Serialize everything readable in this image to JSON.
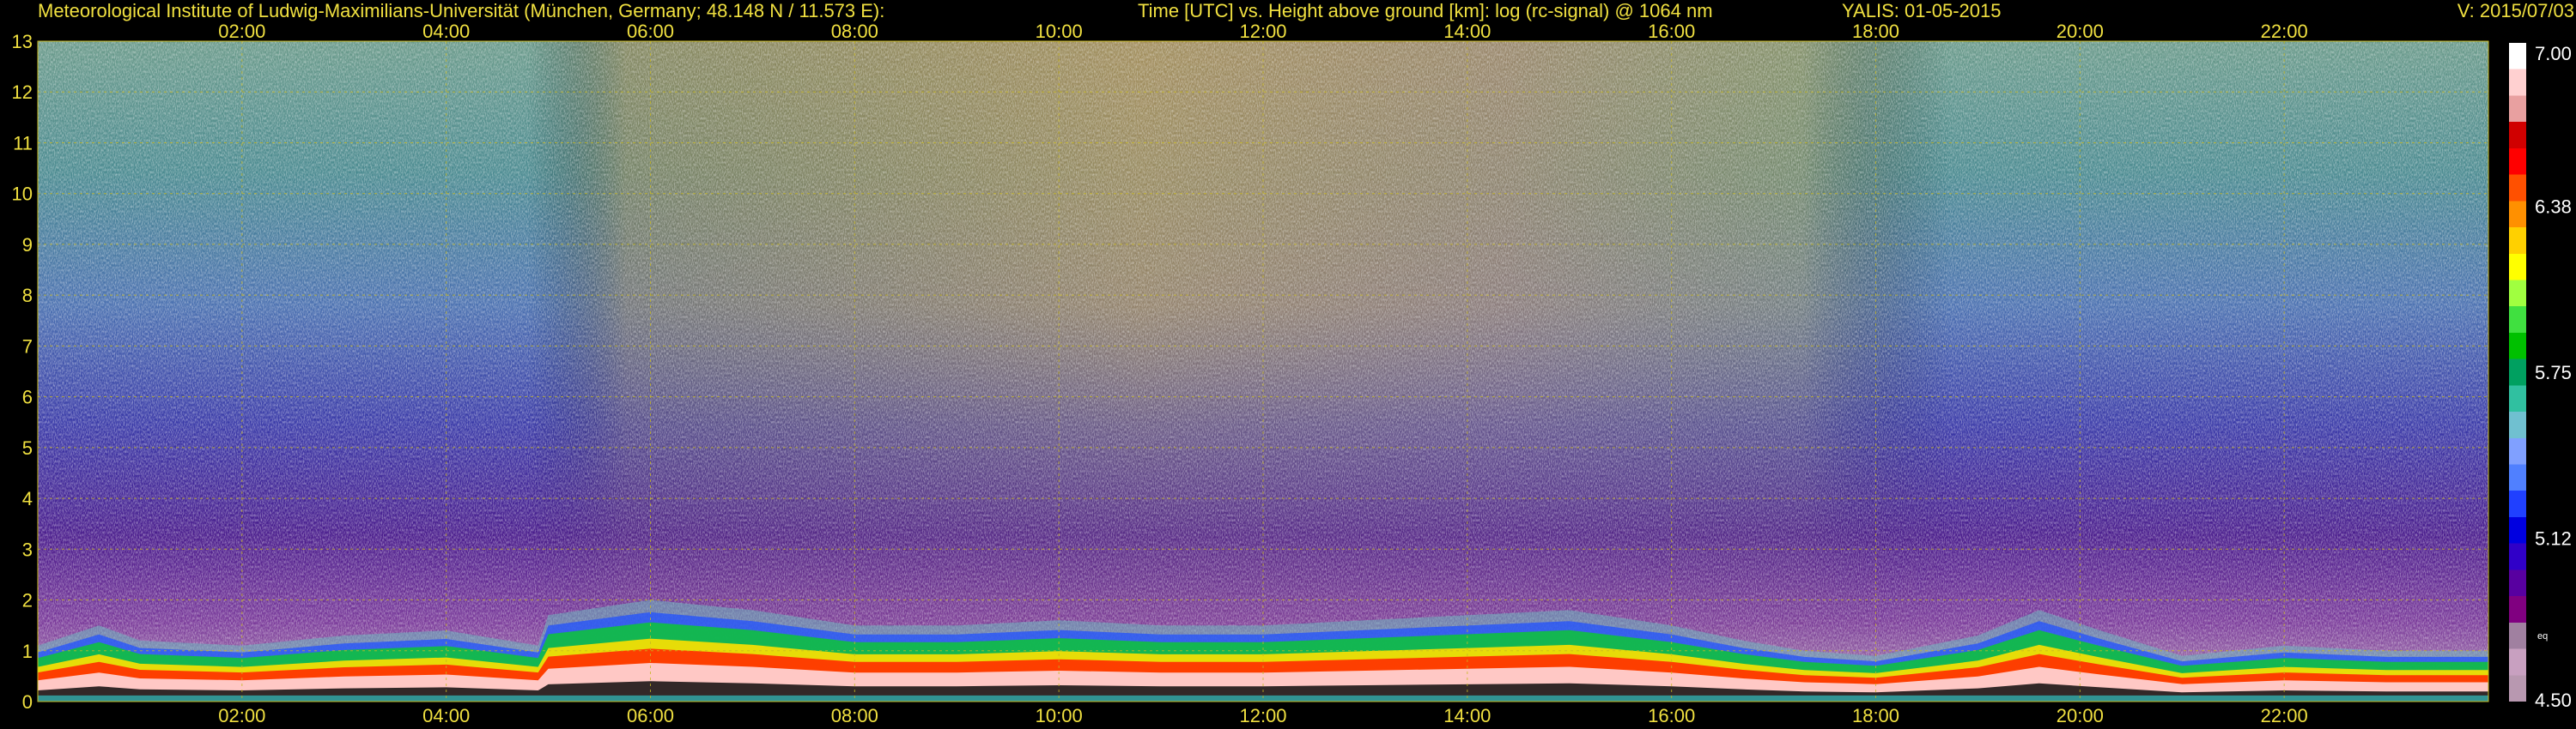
{
  "header": {
    "institute": "Meteorological Institute of Ludwig-Maximilians-Universität (München, Germany; 48.148 N / 11.573 E):",
    "axes_description": "Time [UTC] vs. Height above ground [km]: log (rc-signal) @ 1064 nm",
    "instrument_date": "YALIS: 01-05-2015",
    "version": "V: 2015/07/03"
  },
  "colors": {
    "background": "#000000",
    "text": "#f0e040",
    "grid": "#c8b820",
    "colorbar_label": "#ffffff"
  },
  "chart_data": {
    "type": "heatmap",
    "title": "Time [UTC] vs. Height above ground [km]: log (rc-signal) @ 1064 nm",
    "xlabel": "Time [UTC]",
    "ylabel": "Height above ground [km]",
    "x_ticks": [
      "02:00",
      "04:00",
      "06:00",
      "08:00",
      "10:00",
      "12:00",
      "14:00",
      "16:00",
      "18:00",
      "20:00",
      "22:00"
    ],
    "x_tick_hours": [
      2,
      4,
      6,
      8,
      10,
      12,
      14,
      16,
      18,
      20,
      22
    ],
    "xlim_hours": [
      0,
      24
    ],
    "y_ticks": [
      "0",
      "1",
      "2",
      "3",
      "4",
      "5",
      "6",
      "7",
      "8",
      "9",
      "10",
      "11",
      "12",
      "13"
    ],
    "y_tick_values": [
      0,
      1,
      2,
      3,
      4,
      5,
      6,
      7,
      8,
      9,
      10,
      11,
      12,
      13
    ],
    "ylim_km": [
      0,
      13
    ],
    "grid": true,
    "colorbar": {
      "labels": [
        "7.00",
        "6.38",
        "5.75",
        "5.12",
        "4.50"
      ],
      "label_values": [
        7.0,
        6.38,
        5.75,
        5.12,
        4.5
      ],
      "range": [
        4.5,
        7.0
      ],
      "small_label": "eq",
      "colors": [
        "#b898b0",
        "#c8a0c0",
        "#a080a0",
        "#800080",
        "#5800a0",
        "#3000c8",
        "#0000e0",
        "#2040ff",
        "#5080ff",
        "#80a0ff",
        "#70c0d0",
        "#30c0a0",
        "#00a060",
        "#00c000",
        "#40e040",
        "#a0ff40",
        "#ffff00",
        "#ffd000",
        "#ff9000",
        "#ff5000",
        "#ff0000",
        "#d00000",
        "#e8a0a0",
        "#ffd0d0",
        "#ffffff"
      ]
    },
    "boundary_layer_top_km": [
      [
        0.0,
        1.1
      ],
      [
        0.6,
        1.5
      ],
      [
        1.0,
        1.2
      ],
      [
        2.0,
        1.1
      ],
      [
        3.0,
        1.3
      ],
      [
        4.0,
        1.4
      ],
      [
        4.9,
        1.1
      ],
      [
        5.0,
        1.7
      ],
      [
        6.0,
        2.0
      ],
      [
        7.0,
        1.8
      ],
      [
        8.0,
        1.5
      ],
      [
        9.0,
        1.5
      ],
      [
        10.0,
        1.6
      ],
      [
        11.0,
        1.5
      ],
      [
        12.0,
        1.5
      ],
      [
        13.0,
        1.6
      ],
      [
        14.0,
        1.7
      ],
      [
        15.0,
        1.8
      ],
      [
        16.0,
        1.5
      ],
      [
        16.7,
        1.2
      ],
      [
        17.3,
        1.0
      ],
      [
        18.0,
        0.9
      ],
      [
        19.0,
        1.3
      ],
      [
        19.6,
        1.8
      ],
      [
        20.2,
        1.4
      ],
      [
        21.0,
        0.9
      ],
      [
        22.0,
        1.1
      ],
      [
        23.0,
        1.0
      ],
      [
        24.0,
        1.0
      ]
    ]
  }
}
